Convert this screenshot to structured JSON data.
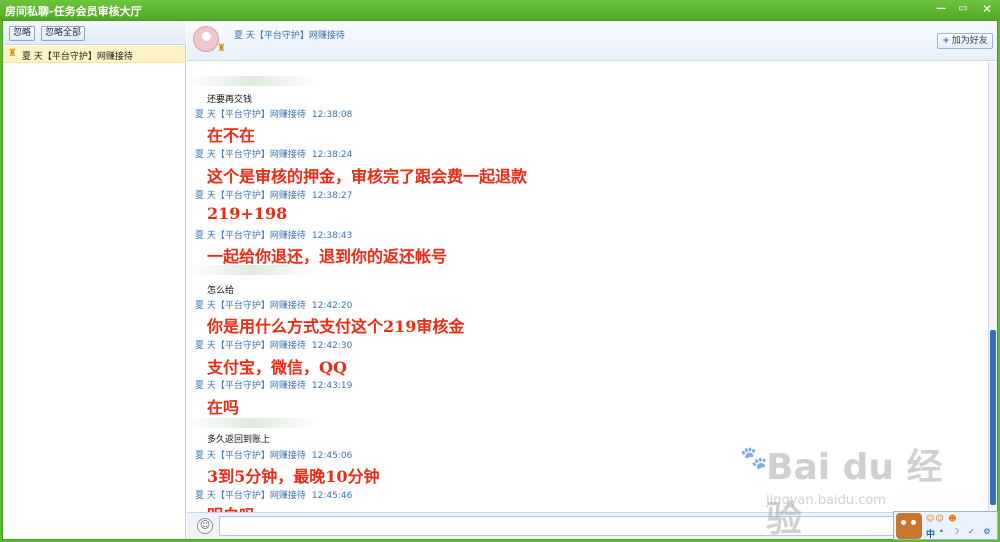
{
  "window": {
    "title": "房间私聊-任务会员审核大厅",
    "min_glyph": "—",
    "max_glyph": "▭",
    "close_glyph": "✕"
  },
  "left_panel": {
    "ignore_label": "忽略",
    "ignore_all_label": "忽略全部",
    "contact": {
      "icon": "user-badge-icon",
      "name": "夏 天【平台守护】网赚接待"
    }
  },
  "chat_header": {
    "name": "夏 天【平台守护】网赚接待",
    "add_friend_label": "加为好友"
  },
  "messages": [
    {
      "type": "received",
      "text": "还要再交钱"
    },
    {
      "type": "sent",
      "sender": "夏 天【平台守护】网赚接待",
      "time": "12:38:08",
      "text": "在不在"
    },
    {
      "type": "sent",
      "sender": "夏 天【平台守护】网赚接待",
      "time": "12:38:24",
      "text": "这个是审核的押金，审核完了跟会费一起退款"
    },
    {
      "type": "sent",
      "sender": "夏 天【平台守护】网赚接待",
      "time": "12:38:27",
      "text": "219+198"
    },
    {
      "type": "sent",
      "sender": "夏 天【平台守护】网赚接待",
      "time": "12:38:43",
      "text": "一起给你退还，退到你的返还帐号"
    },
    {
      "type": "received",
      "text": "怎么给"
    },
    {
      "type": "sent",
      "sender": "夏 天【平台守护】网赚接待",
      "time": "12:42:20",
      "text": "你是用什么方式支付这个219审核金"
    },
    {
      "type": "sent",
      "sender": "夏 天【平台守护】网赚接待",
      "time": "12:42:30",
      "text": "支付宝，微信，QQ"
    },
    {
      "type": "sent",
      "sender": "夏 天【平台守护】网赚接待",
      "time": "12:43:19",
      "text": "在吗"
    },
    {
      "type": "received",
      "text": "多久返回到账上"
    },
    {
      "type": "sent",
      "sender": "夏 天【平台守护】网赚接待",
      "time": "12:45:06",
      "text": "3到5分钟，最晚10分钟"
    },
    {
      "type": "sent",
      "sender": "夏 天【平台守护】网赚接待",
      "time": "12:45:46",
      "text": "明白吗"
    }
  ],
  "input": {
    "emoji_icon": "smiley-icon",
    "value": ""
  },
  "ime": {
    "mode": "中",
    "tools": "• ☽ ✓ ⚙",
    "status": "☺☺ ☻"
  },
  "watermark": {
    "main": "Bai du 经验",
    "sub": "jingyan.baidu.com"
  },
  "colors": {
    "title_bar": "#5fb832",
    "message_text": "#ee2a14",
    "meta_text": "#3a72b8",
    "contact_highlight": "#fdf3c4"
  }
}
